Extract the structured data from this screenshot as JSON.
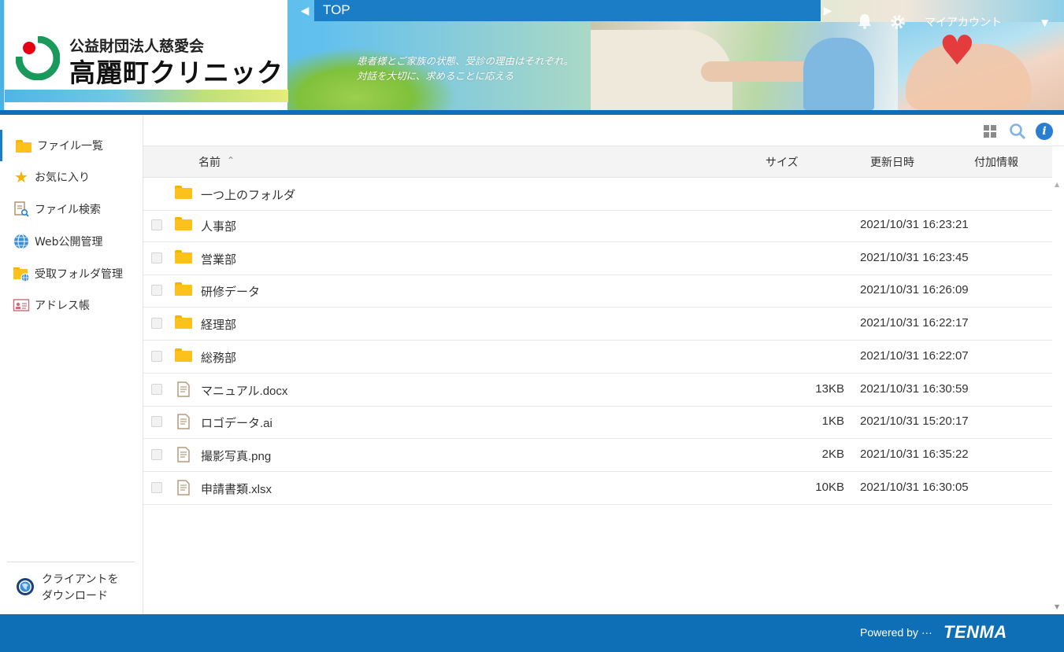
{
  "header": {
    "org_name": "公益財団法人慈愛会",
    "clinic_name": "高麗町クリニック",
    "tagline_line1": "患者様とご家族の状態、受診の理由はそれぞれ。",
    "tagline_line2": "対話を大切に、求めることに応える",
    "nav_title": "TOP",
    "account_label": "マイアカウント"
  },
  "sidebar": {
    "items": [
      {
        "label": "ファイル一覧",
        "icon": "folder-icon"
      },
      {
        "label": "お気に入り",
        "icon": "star-icon"
      },
      {
        "label": "ファイル検索",
        "icon": "file-search-icon"
      },
      {
        "label": "Web公開管理",
        "icon": "globe-icon"
      },
      {
        "label": "受取フォルダ管理",
        "icon": "folder-globe-icon"
      },
      {
        "label": "アドレス帳",
        "icon": "address-card-icon"
      }
    ],
    "client_download_line1": "クライアントを",
    "client_download_line2": "ダウンロード"
  },
  "table": {
    "columns": {
      "name": "名前",
      "size": "サイズ",
      "date": "更新日時",
      "extra": "付加情報"
    },
    "parent_folder_label": "一つ上のフォルダ",
    "rows": [
      {
        "name": "人事部",
        "type": "folder",
        "size": "",
        "date": "2021/10/31 16:23:21"
      },
      {
        "name": "営業部",
        "type": "folder",
        "size": "",
        "date": "2021/10/31 16:23:45"
      },
      {
        "name": "研修データ",
        "type": "folder",
        "size": "",
        "date": "2021/10/31 16:26:09"
      },
      {
        "name": "経理部",
        "type": "folder",
        "size": "",
        "date": "2021/10/31 16:22:17"
      },
      {
        "name": "総務部",
        "type": "folder",
        "size": "",
        "date": "2021/10/31 16:22:07"
      },
      {
        "name": "マニュアル.docx",
        "type": "file",
        "size": "13KB",
        "date": "2021/10/31 16:30:59"
      },
      {
        "name": "ロゴデータ.ai",
        "type": "file",
        "size": "1KB",
        "date": "2021/10/31 15:20:17"
      },
      {
        "name": "撮影写真.png",
        "type": "file",
        "size": "2KB",
        "date": "2021/10/31 16:35:22"
      },
      {
        "name": "申請書類.xlsx",
        "type": "file",
        "size": "10KB",
        "date": "2021/10/31 16:30:05"
      }
    ]
  },
  "footer": {
    "powered_by": "Powered by ···",
    "brand": "TENMA"
  },
  "colors": {
    "primary": "#0e6fb7",
    "nav_bar": "#1a7dc6",
    "folder": "#fcc21b",
    "info": "#2a7ed2"
  }
}
